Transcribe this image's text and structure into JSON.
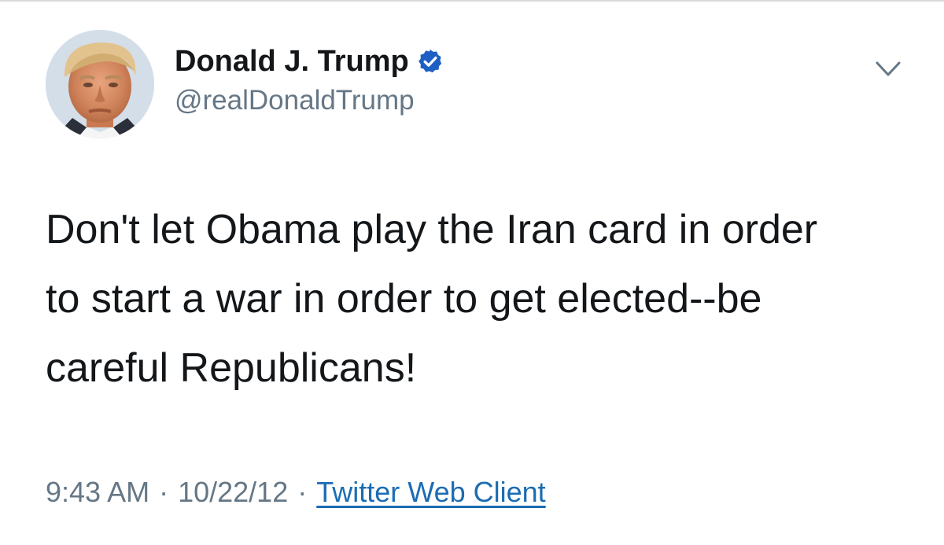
{
  "author": {
    "display_name": "Donald J. Trump",
    "handle": "@realDonaldTrump",
    "verified": true,
    "verified_color": "#1d5fc4"
  },
  "tweet": {
    "text_lines": [
      "Don't let Obama play the Iran card in order",
      "to start a war in order to get elected--be",
      "careful Republicans!"
    ],
    "time": "9:43 AM",
    "separator": "·",
    "date": "10/22/12",
    "source": "Twitter Web Client"
  },
  "colors": {
    "text": "#14171a",
    "secondary": "#657786",
    "link": "#1b6cb3"
  },
  "icons": {
    "menu": "chevron-down-icon",
    "badge": "verified-badge-icon"
  }
}
